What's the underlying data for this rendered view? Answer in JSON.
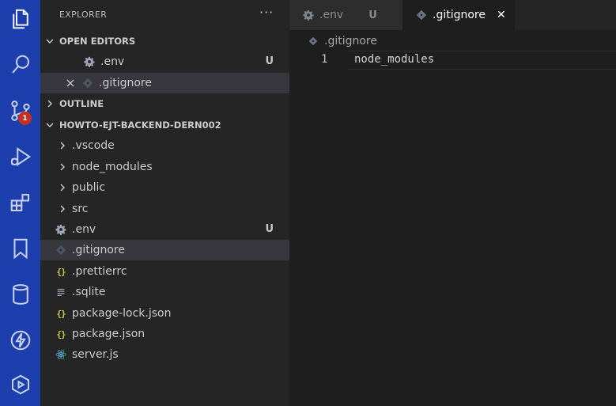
{
  "activity_bar": {
    "items": [
      "explorer-icon",
      "search-icon",
      "source-control-icon",
      "run-debug-icon",
      "extensions-icon",
      "bookmarks-icon",
      "database-icon",
      "lightning-icon",
      "azure-icon"
    ],
    "scm_badge": "1",
    "background": "#1d3fae"
  },
  "sidebar": {
    "title": "EXPLORER",
    "more": "···",
    "open_editors": {
      "header": "OPEN EDITORS",
      "items": [
        {
          "name": ".env",
          "status": "U"
        },
        {
          "name": ".gitignore",
          "status": ""
        }
      ]
    },
    "outline": {
      "header": "OUTLINE"
    },
    "project": {
      "header": "HOWTO-EJT-BACKEND-DERN002",
      "folders": [
        ".vscode",
        "node_modules",
        "public",
        "src"
      ],
      "files": [
        {
          "name": ".env",
          "icon": "gear-icon",
          "status": "U"
        },
        {
          "name": ".gitignore",
          "icon": "git-icon",
          "status": ""
        },
        {
          "name": ".prettierrc",
          "icon": "json-icon",
          "status": ""
        },
        {
          "name": ".sqlite",
          "icon": "lines-icon",
          "status": ""
        },
        {
          "name": "package-lock.json",
          "icon": "json-icon",
          "status": ""
        },
        {
          "name": "package.json",
          "icon": "json-icon",
          "status": ""
        },
        {
          "name": "server.js",
          "icon": "react-icon",
          "status": ""
        }
      ]
    }
  },
  "editor": {
    "tabs": [
      {
        "name": ".env",
        "status": "U",
        "active": false
      },
      {
        "name": ".gitignore",
        "close": "✕",
        "active": true
      }
    ],
    "breadcrumb": ".gitignore",
    "lines": [
      {
        "number": "1",
        "text": "node_modules"
      }
    ]
  },
  "json_icon_glyph": "{}",
  "colors": {
    "sidebar_bg": "#252526",
    "editor_bg": "#1e1e1e",
    "selected_row": "#37373d",
    "badge": "#c72e24"
  }
}
